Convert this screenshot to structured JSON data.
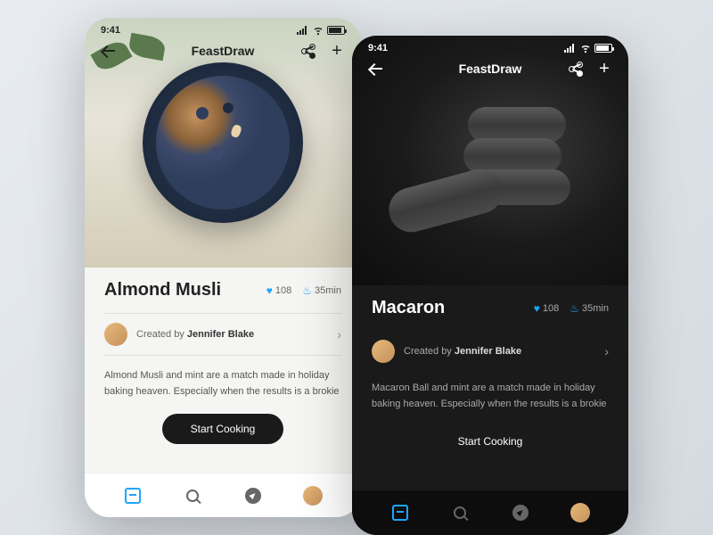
{
  "status": {
    "time": "9:41"
  },
  "header": {
    "app_name": "FeastDraw"
  },
  "light": {
    "title": "Almond Musli",
    "likes": "108",
    "cook_time": "35min",
    "author_prefix": "Created by ",
    "author_name": "Jennifer Blake",
    "description": "Almond Musli and mint are a match made in holiday baking heaven. Especially when the results is a brokie",
    "cta": "Start Cooking"
  },
  "dark": {
    "title": "Macaron",
    "likes": "108",
    "cook_time": "35min",
    "author_prefix": "Created by ",
    "author_name": "Jennifer Blake",
    "description": "Macaron Ball and mint are a match made in holiday baking heaven. Especially when the results is a brokie",
    "cta": "Start Cooking"
  }
}
